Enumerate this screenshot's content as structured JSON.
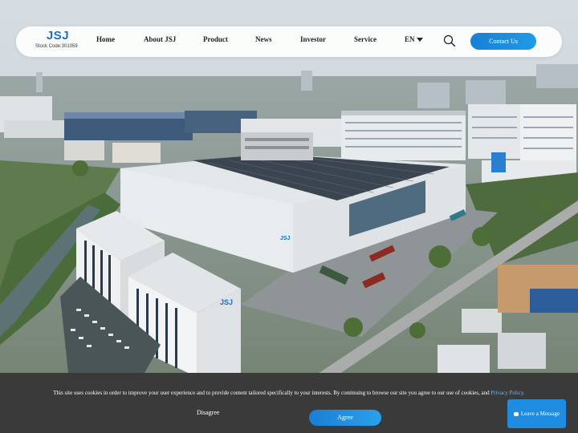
{
  "brand": {
    "logo_text": "JSJ",
    "stock_code": "Stock Code:301059"
  },
  "nav": {
    "items": [
      {
        "label": "Home"
      },
      {
        "label": "About JSJ"
      },
      {
        "label": "Product"
      },
      {
        "label": "News"
      },
      {
        "label": "Investor"
      },
      {
        "label": "Service"
      }
    ],
    "language": "EN",
    "contact_label": "Contact Us"
  },
  "hero": {
    "building_sign": "JSJ",
    "tower_sign": "JSJ"
  },
  "cookie": {
    "message": "This site uses cookies in order to improve your user experience and to provide content tailored specifically to your interests. By continuing to browse our site you agree to our use of cookies, and ",
    "policy_link": "Privacy Policy.",
    "disagree_label": "Disagree",
    "agree_label": "Agree"
  },
  "chat": {
    "label": "Leave a Message"
  },
  "colors": {
    "accent": "#1a7fd4",
    "cookie_bg": "#3a3a3a",
    "link": "#6fb6ff"
  }
}
